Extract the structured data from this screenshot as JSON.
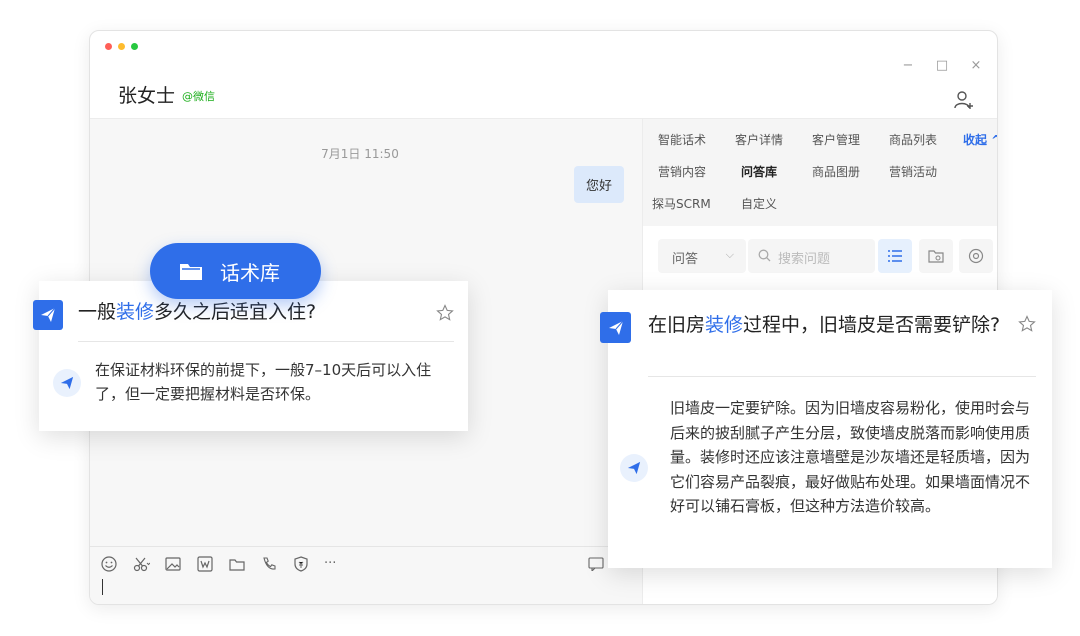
{
  "window": {
    "contact_name": "张女士",
    "contact_tag": "@微信",
    "controls": {
      "minimize": "−",
      "maximize": "□",
      "close": "×"
    }
  },
  "chat": {
    "timestamp": "7月1日 11:50",
    "messages": [
      {
        "from": "me",
        "text": "您好"
      }
    ]
  },
  "side_panel": {
    "tabs": [
      {
        "label": "智能话术"
      },
      {
        "label": "客户详情"
      },
      {
        "label": "客户管理"
      },
      {
        "label": "商品列表"
      },
      {
        "label": "收起 ^"
      },
      {
        "label": "营销内容"
      },
      {
        "label": "问答库"
      },
      {
        "label": "商品图册"
      },
      {
        "label": "营销活动"
      },
      {
        "label": "探马SCRM"
      },
      {
        "label": "自定义"
      }
    ],
    "active_tab": "问答库",
    "filter": {
      "selected": "问答",
      "chevron": "⌵"
    },
    "search": {
      "placeholder": "搜索问题"
    }
  },
  "pill": {
    "label": "话术库"
  },
  "card_left": {
    "question_pre": "一般",
    "question_hl": "装修",
    "question_post": "多久之后适宜入住?",
    "answer": "在保证材料环保的前提下，一般7–10天后可以入住了，但一定要把握材料是否环保。"
  },
  "card_right": {
    "question_pre": "在旧房",
    "question_hl": "装修",
    "question_post": "过程中，旧墙皮是否需要铲除?",
    "answer": "旧墙皮一定要铲除。因为旧墙皮容易粉化，使用时会与后来的披刮腻子产生分层，致使墙皮脱落而影响使用质量。装修时还应该注意墙壁是沙灰墙还是轻质墙，因为它们容易产品裂痕，最好做贴布处理。如果墙面情况不好可以铺石膏板，但这种方法造价较高。"
  },
  "toolbar": {
    "more": "···",
    "icons": [
      "emoji-icon",
      "scissors-icon",
      "image-icon",
      "word-icon",
      "folder-icon",
      "phone-icon",
      "redpacket-icon",
      "more-icon"
    ]
  },
  "colors": {
    "accent": "#2f6ee9",
    "wechat_green": "#1aad19",
    "bubble": "#dce9fb"
  }
}
